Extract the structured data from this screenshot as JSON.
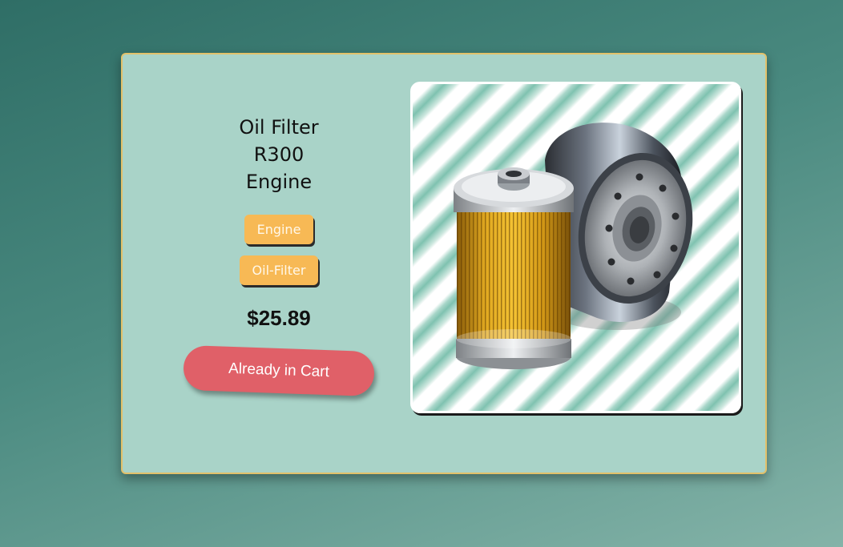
{
  "product": {
    "title": "Oil Filter R300 Engine",
    "tags": [
      "Engine",
      "Oil-Filter"
    ],
    "price": "$25.89",
    "cart_button_label": "Already in Cart",
    "image_icon": "oil-filter-product-image"
  },
  "colors": {
    "card_background": "#a9d3c8",
    "card_border": "#e2c16a",
    "tag_background": "#f7b955",
    "cart_button": "#e06068"
  }
}
